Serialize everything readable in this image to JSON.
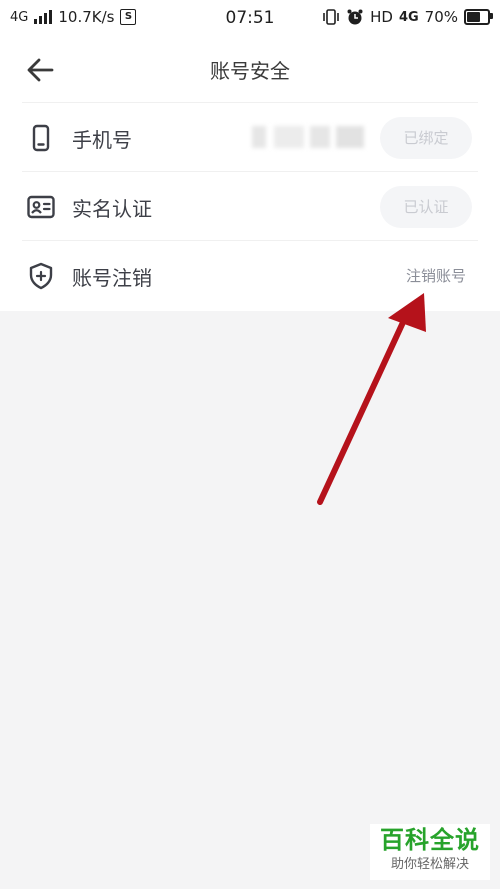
{
  "status_bar": {
    "network_type": "4G",
    "speed": "10.7K/s",
    "sim_badge": "S",
    "time": "07:51",
    "hd": "HD",
    "network_right": "4G",
    "battery_percent": "70%",
    "battery_level": 0.7
  },
  "header": {
    "title": "账号安全"
  },
  "rows": [
    {
      "label": "手机号",
      "action": "已绑定",
      "icon": "phone-icon"
    },
    {
      "label": "实名认证",
      "action": "已认证",
      "icon": "id-card-icon"
    },
    {
      "label": "账号注销",
      "action": "注销账号",
      "icon": "shield-plus-icon"
    }
  ],
  "watermark": {
    "main": "百科全说",
    "sub": "助你轻松解决"
  },
  "colors": {
    "background": "#f4f4f5",
    "surface": "#ffffff",
    "annotation_arrow": "#b5121b",
    "watermark_green": "#27a32b"
  }
}
